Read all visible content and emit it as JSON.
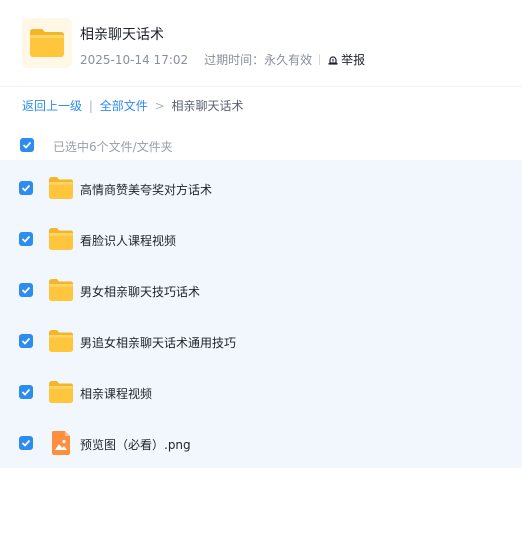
{
  "header": {
    "title": "相亲聊天话术",
    "date": "2025-10-14 17:02",
    "expiry": "过期时间：永久有效",
    "report_label": "举报"
  },
  "breadcrumb": {
    "back": "返回上一级",
    "sep": "|",
    "all": "全部文件",
    "arrow": ">",
    "current": "相亲聊天话术"
  },
  "selection": {
    "label": "已选中6个文件/文件夹",
    "checked": true
  },
  "files": [
    {
      "name": "高情商赞美夸奖对方话术",
      "type": "folder",
      "checked": true
    },
    {
      "name": "看脸识人课程视频",
      "type": "folder",
      "checked": true
    },
    {
      "name": "男女相亲聊天技巧话术",
      "type": "folder",
      "checked": true
    },
    {
      "name": "男追女相亲聊天话术通用技巧",
      "type": "folder",
      "checked": true
    },
    {
      "name": "相亲课程视频",
      "type": "folder",
      "checked": true
    },
    {
      "name": "预览图（必看）.png",
      "type": "image",
      "checked": true
    }
  ],
  "colors": {
    "accent": "#2d8cf0",
    "folder": "#ffc53d",
    "image_file": "#ff8f3f",
    "list_bg": "#f1f7fd"
  }
}
